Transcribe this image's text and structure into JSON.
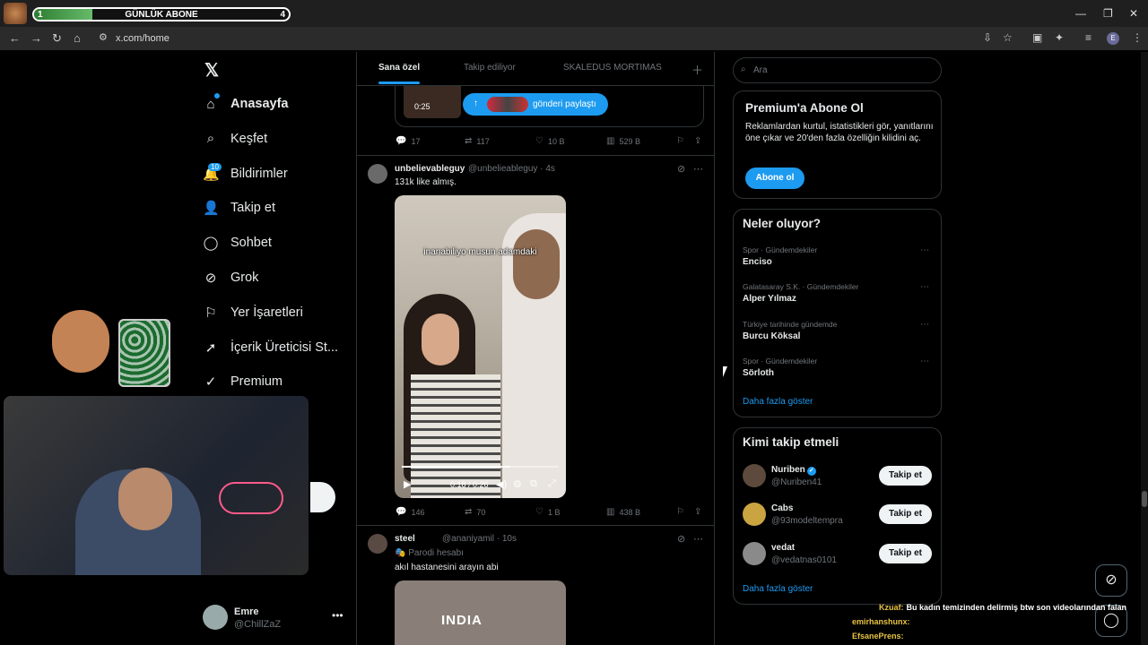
{
  "overlay": {
    "sub_goal": {
      "start": "1",
      "title": "GÜNLÜK ABONE",
      "end": "4",
      "progress_fraction": 0.23
    }
  },
  "browser": {
    "url": "x.com/home",
    "profile_letter": "E"
  },
  "sidebar": {
    "items": [
      {
        "label": "Anasayfa",
        "icon": "home-icon"
      },
      {
        "label": "Keşfet",
        "icon": "search-icon"
      },
      {
        "label": "Bildirimler",
        "icon": "bell-icon"
      },
      {
        "label": "Takip et",
        "icon": "add-user-icon"
      },
      {
        "label": "Sohbet",
        "icon": "chat-icon"
      },
      {
        "label": "Grok",
        "icon": "grok-icon"
      },
      {
        "label": "Yer İşaretleri",
        "icon": "bookmark-icon"
      },
      {
        "label": "İçerik Üreticisi St...",
        "icon": "rocket-icon"
      },
      {
        "label": "Premium",
        "icon": "premium-icon"
      }
    ],
    "notification_count": "10",
    "account": {
      "name": "Emre",
      "handle": "@ChillZaZ"
    }
  },
  "tabs": [
    "Sana özel",
    "Takip ediliyor",
    "SKALEDUS MORTIMAS"
  ],
  "tweets": {
    "top": {
      "video_time": "0:25",
      "share_label": "gönderi paylaştı",
      "replies": "17",
      "reposts": "117",
      "likes": "10 B",
      "views": "529 B"
    },
    "second": {
      "name": "unbelievableguy",
      "meta": "@unbelieableguy · 4s",
      "text": "131k like almış.",
      "caption": "inanabiliyo musun adamdaki",
      "time": "0:18 / 0:26",
      "progress_fraction": 0.69,
      "replies": "146",
      "reposts": "70",
      "likes": "1 B",
      "views": "438 B"
    },
    "third": {
      "name": "steel",
      "meta": "@ananiyamil · 10s",
      "parody": "Parodi hesabı",
      "text": "akıl hastanesini arayın abi",
      "image_text": "INDIA"
    }
  },
  "right": {
    "search_placeholder": "Ara",
    "premium": {
      "title": "Premium'a Abone Ol",
      "text": "Reklamlardan kurtul, istatistikleri gör, yanıtlarını öne çıkar ve 20'den fazla özelliğin kilidini aç.",
      "button": "Abone ol"
    },
    "trends": {
      "title": "Neler oluyor?",
      "items": [
        {
          "category": "Spor · Gündemdekiler",
          "name": "Enciso"
        },
        {
          "category": "Galatasaray S.K. · Gündemdekiler",
          "name": "Alper Yılmaz"
        },
        {
          "category": "Türkiye tarihinde gündemde",
          "name": "Burcu Köksal"
        },
        {
          "category": "Spor · Gündemdekiler",
          "name": "Sörloth"
        }
      ],
      "more": "Daha fazla göster"
    },
    "follow": {
      "title": "Kimi takip etmeli",
      "items": [
        {
          "name": "Nuriben",
          "handle": "@Nuriben41",
          "verified": true,
          "button": "Takip et"
        },
        {
          "name": "Cabs",
          "handle": "@93modeltempra",
          "verified": false,
          "button": "Takip et"
        },
        {
          "name": "vedat",
          "handle": "@vedatnas0101",
          "verified": false,
          "button": "Takip et"
        }
      ],
      "more": "Daha fazla göster"
    }
  },
  "chat": [
    {
      "user": "Kzuaf:",
      "message": "Bu kadın temizinden delirmiş btw son videolarından falan"
    },
    {
      "user": "emirhanshunx:",
      "message": ""
    },
    {
      "user": "EfsanePrens:",
      "message": ""
    }
  ]
}
